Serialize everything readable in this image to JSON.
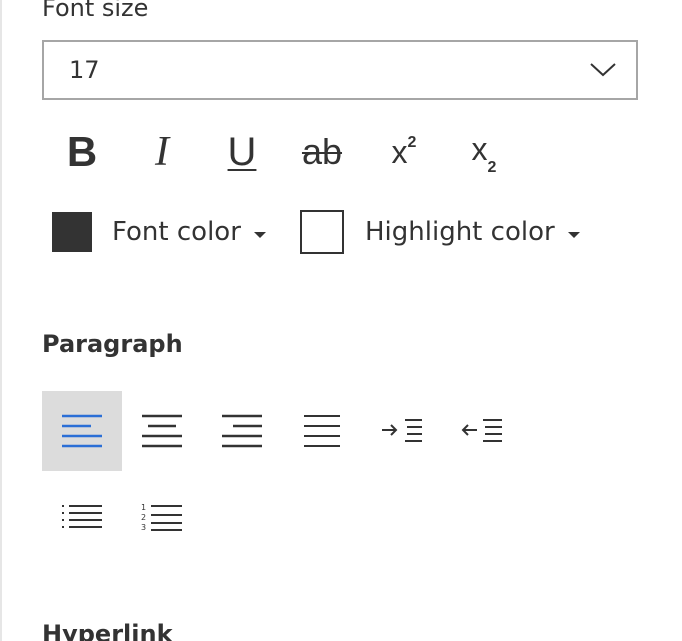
{
  "font_size": {
    "label": "Font size",
    "value": "17"
  },
  "format_buttons": [
    {
      "name": "bold",
      "glyph": "B"
    },
    {
      "name": "italic",
      "glyph": "I"
    },
    {
      "name": "underline",
      "glyph": "U"
    },
    {
      "name": "strikethrough",
      "glyph": "ab"
    },
    {
      "name": "superscript",
      "glyph": "x",
      "mark": "2"
    },
    {
      "name": "subscript",
      "glyph": "x",
      "mark": "2"
    }
  ],
  "font_color": {
    "label": "Font color",
    "swatch": "#333333"
  },
  "highlight_color": {
    "label": "Highlight color",
    "swatch": "#ffffff"
  },
  "paragraph": {
    "label": "Paragraph",
    "selected_alignment": "align-left",
    "buttons": [
      {
        "name": "align-left",
        "icon": "align-left-icon"
      },
      {
        "name": "align-center",
        "icon": "align-center-icon"
      },
      {
        "name": "align-right",
        "icon": "align-right-icon"
      },
      {
        "name": "justify",
        "icon": "justify-icon"
      },
      {
        "name": "indent",
        "icon": "indent-icon"
      },
      {
        "name": "outdent",
        "icon": "outdent-icon"
      },
      {
        "name": "bulleted-list",
        "icon": "bulleted-list-icon"
      },
      {
        "name": "numbered-list",
        "icon": "numbered-list-icon"
      }
    ],
    "numbered_list_digits": [
      "1",
      "2",
      "3"
    ]
  },
  "hyperlink": {
    "label": "Hyperlink"
  },
  "colors": {
    "accent": "#2b6fd6",
    "text": "#333333",
    "selected_bg": "#dcdcdc",
    "border": "#a6a6a6"
  }
}
